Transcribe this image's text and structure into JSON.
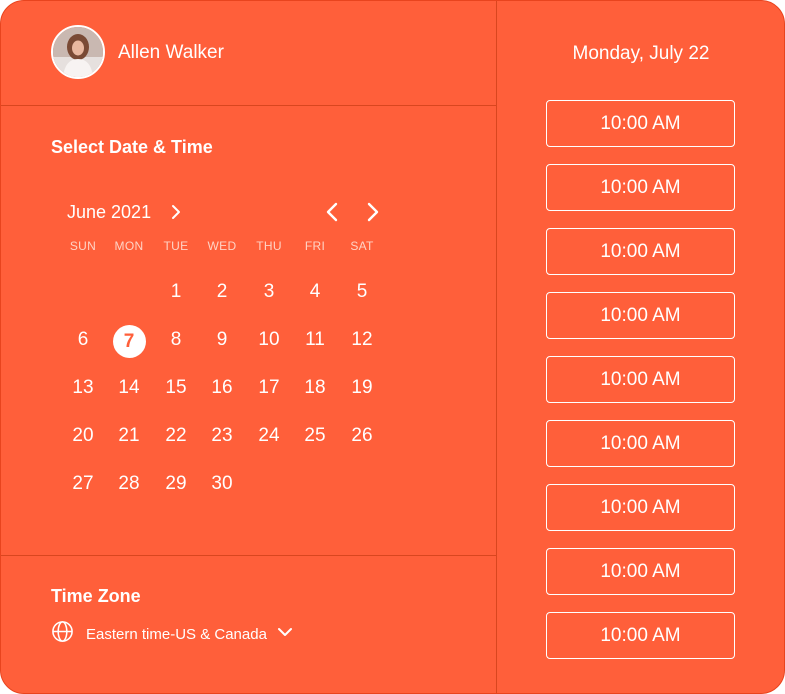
{
  "user": {
    "name": "Allen Walker"
  },
  "section_titles": {
    "select": "Select Date & Time",
    "timezone": "Time Zone"
  },
  "calendar": {
    "month_label": "June 2021",
    "weekdays": [
      "SUN",
      "MON",
      "TUE",
      "WED",
      "THU",
      "FRI",
      "SAT"
    ],
    "selected_day": "7",
    "weeks": [
      [
        "",
        "",
        "1",
        "2",
        "3",
        "4",
        "5"
      ],
      [
        "6",
        "7",
        "8",
        "9",
        "10",
        "11",
        "12"
      ],
      [
        "13",
        "14",
        "15",
        "16",
        "17",
        "18",
        "19"
      ],
      [
        "20",
        "21",
        "22",
        "23",
        "24",
        "25",
        "26"
      ],
      [
        "27",
        "28",
        "29",
        "30",
        "",
        "",
        ""
      ]
    ]
  },
  "timezone": {
    "label": "Eastern time-US & Canada"
  },
  "schedule": {
    "date": "Monday, July 22",
    "slots": [
      "10:00 AM",
      "10:00 AM",
      "10:00 AM",
      "10:00 AM",
      "10:00 AM",
      "10:00 AM",
      "10:00 AM",
      "10:00 AM",
      "10:00 AM"
    ]
  },
  "icons": {
    "month": "chevron-right-icon",
    "prev": "chevron-left-icon",
    "next": "chevron-right-icon",
    "timezone": "globe-icon",
    "dropdown": "chevron-down-icon"
  },
  "colors": {
    "background": "#FF5F3A",
    "foreground": "#FFFFFF",
    "divider": "#D9461F"
  }
}
